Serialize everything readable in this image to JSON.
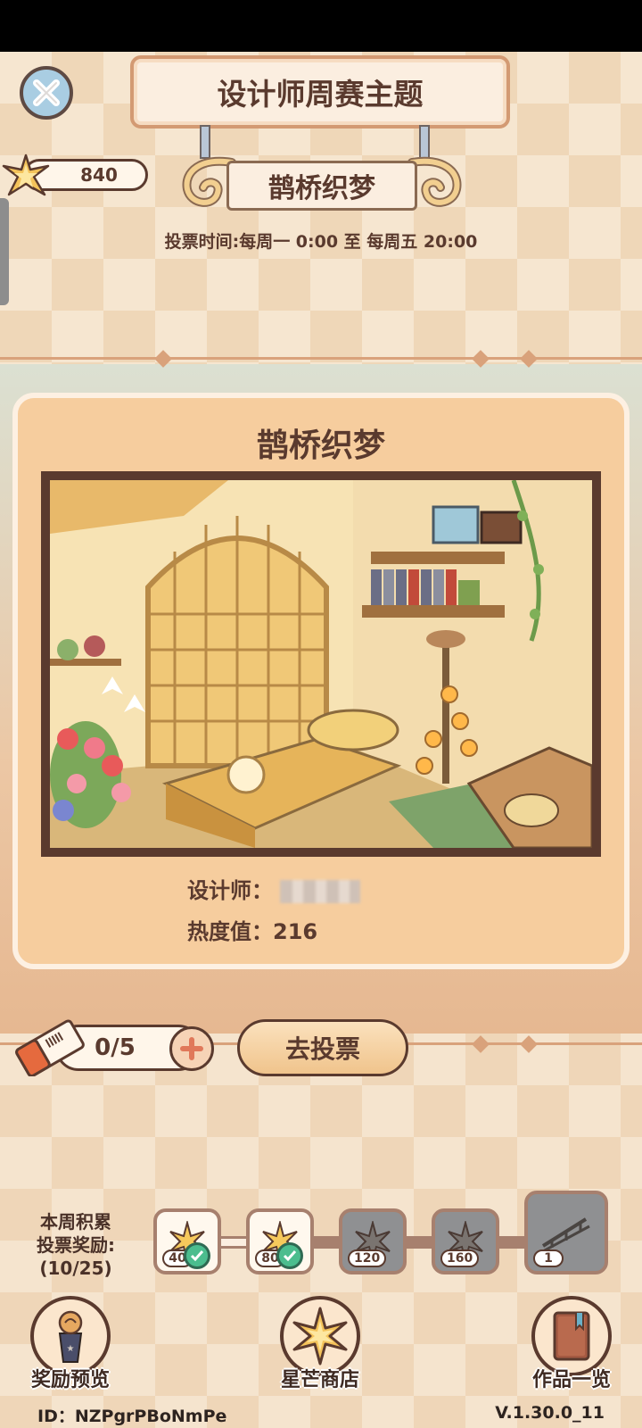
{
  "header": {
    "title": "设计师周赛主题",
    "theme_name": "鹊桥织梦",
    "vote_time": "投票时间:每周一 0:00 至 每周五 20:00",
    "star_count": "840"
  },
  "entry": {
    "title": "鹊桥织梦",
    "designer_label": "设计师：",
    "heat_label": "热度值：",
    "heat_value": "216"
  },
  "vote": {
    "tickets": "0/5",
    "vote_button": "去投票"
  },
  "rewards": {
    "label_line1": "本周积累",
    "label_line2": "投票奖励:",
    "label_line3": "(10/25)",
    "tiers": [
      {
        "threshold": "40",
        "claimed": true
      },
      {
        "threshold": "80",
        "claimed": true
      },
      {
        "threshold": "120",
        "claimed": false
      },
      {
        "threshold": "160",
        "claimed": false
      },
      {
        "threshold": "1",
        "claimed": false
      }
    ]
  },
  "nav": {
    "preview": "奖励预览",
    "shop": "星芒商店",
    "works": "作品一览"
  },
  "footer": {
    "id": "ID：NZPgrPBoNmPe",
    "version": "V.1.30.0_11"
  },
  "colors": {
    "text_brown": "#5a3a2e",
    "card_bg": "#f6cd9e",
    "check_green": "#4bbd8e"
  }
}
